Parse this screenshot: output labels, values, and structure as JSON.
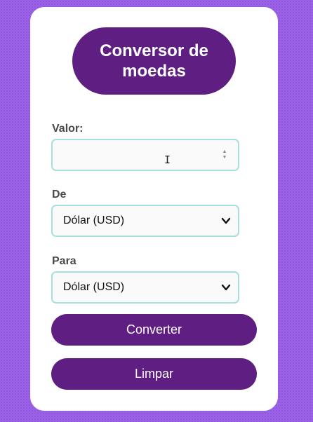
{
  "title": "Conversor de moedas",
  "form": {
    "valor_label": "Valor:",
    "valor_value": "",
    "de_label": "De",
    "de_selected": "Dólar (USD)",
    "para_label": "Para",
    "para_selected": "Dólar (USD)"
  },
  "buttons": {
    "convert": "Converter",
    "clear": "Limpar"
  },
  "icons": {
    "spinner": "number-spinner-icon",
    "cursor": "text-cursor-icon",
    "dropdown": "chevron-down-icon"
  },
  "colors": {
    "background": "#9a60e6",
    "accent": "#5e1e82",
    "field_border": "#a6dfdd"
  }
}
